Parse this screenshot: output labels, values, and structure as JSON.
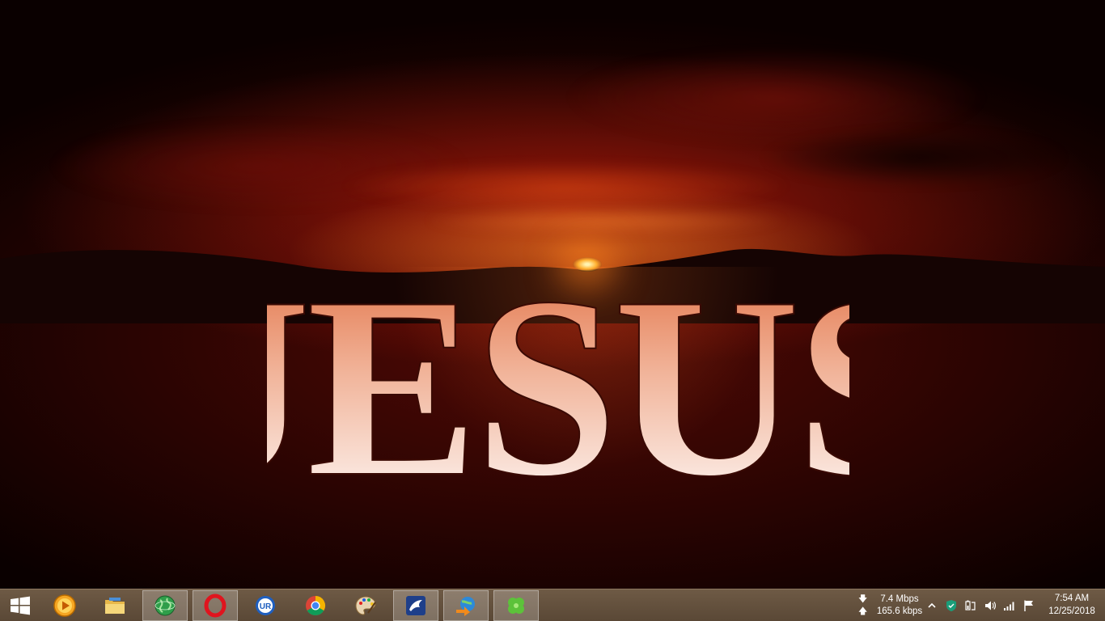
{
  "wallpaper": {
    "title": "JESUS",
    "colors": {
      "sky_red": "#a0180a",
      "sun": "#ffb030",
      "letters_top": "#e7805a",
      "letters_bottom": "#ffffff"
    }
  },
  "taskbar": {
    "pinned": [
      {
        "icon": "windows-start-icon"
      },
      {
        "icon": "media-player-icon"
      },
      {
        "icon": "file-explorer-icon"
      },
      {
        "icon": "globe-network-icon",
        "active": true
      },
      {
        "icon": "opera-browser-icon",
        "active": true
      },
      {
        "icon": "ur-browser-icon"
      },
      {
        "icon": "chrome-browser-icon"
      },
      {
        "icon": "paint-palette-icon"
      },
      {
        "icon": "bird-app-icon",
        "active": true
      },
      {
        "icon": "internet-download-manager-icon",
        "active": true
      },
      {
        "icon": "clover-app-icon",
        "active": true
      }
    ],
    "network": {
      "download": "7.4 Mbps",
      "upload": "165.6 kbps"
    },
    "tray_icons": [
      "show-hidden-icons-chevron",
      "security-shield-icon",
      "battery-power-icon",
      "speaker-volume-icon",
      "wifi-signal-icon",
      "action-center-flag-icon"
    ],
    "clock": {
      "time": "7:54 AM",
      "date": "12/25/2018"
    }
  }
}
